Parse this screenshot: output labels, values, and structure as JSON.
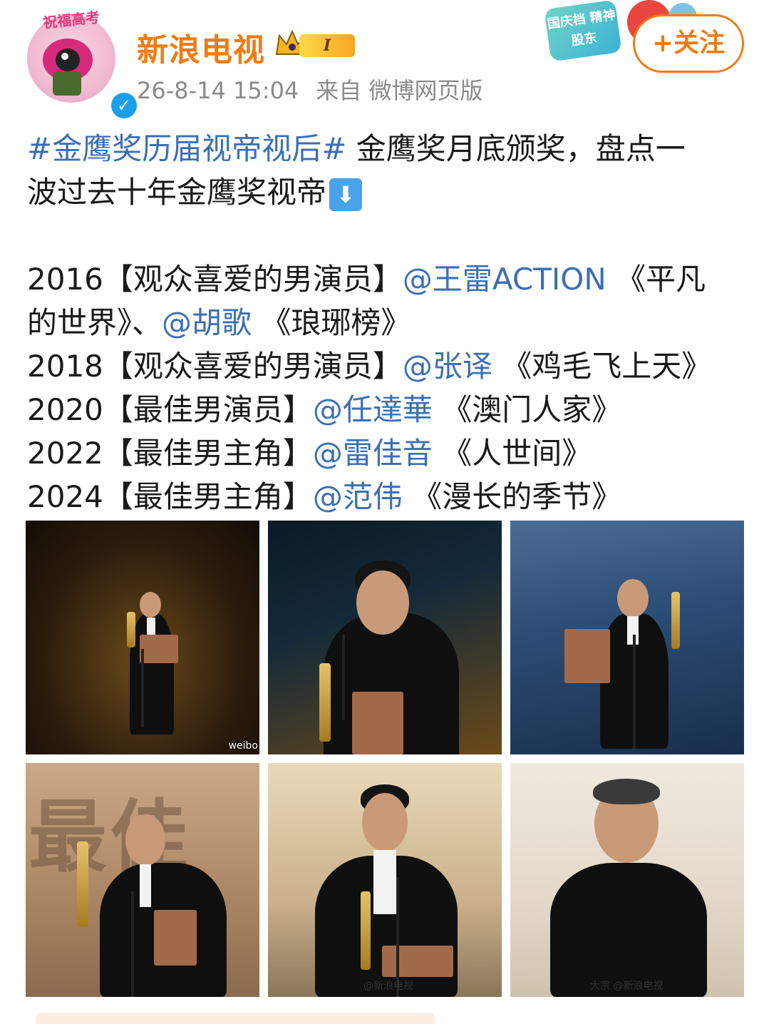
{
  "post": {
    "username": "新浪电视",
    "level": "I",
    "timestamp": "26-8-14 15:04",
    "source": "来自 微博网页版",
    "follow_label": "+关注",
    "avatar_caption": "祝福高考",
    "promo_text": "国庆档 精神股东",
    "body": {
      "hashtag": "#金鹰奖历届视帝视后#",
      "intro_1": " 金鹰奖月底颁奖，盘点一",
      "intro_2": "波过去十年金鹰奖视帝",
      "entries": [
        {
          "year": "2016",
          "category": "【观众喜爱的男演员】",
          "mention": "@王雷ACTION",
          "work": " 《平凡",
          "mention2": "@胡歌",
          "work_cont": "的世界》、",
          "work2": " 《琅琊榜》"
        },
        {
          "year": "2018",
          "category": "【观众喜爱的男演员】",
          "mention": "@张译",
          "work": " 《鸡毛飞上天》"
        },
        {
          "year": "2020",
          "category": "【最佳男演员】",
          "mention": "@任達華",
          "work": " 《澳门人家》"
        },
        {
          "year": "2022",
          "category": "【最佳男主角】",
          "mention": "@雷佳音",
          "work": " 《人世间》"
        },
        {
          "year": "2024",
          "category": "【最佳男主角】",
          "mention": "@范伟",
          "work": " 《漫长的季节》"
        }
      ]
    }
  },
  "photos": {
    "watermark_weibo": "weibo",
    "watermark_sina": "@新浪电视",
    "watermark_sina2": "@新浪电视",
    "watermark_partial": "大宗",
    "p4_backdrop": "最佳"
  },
  "colors": {
    "username": "#f07b12",
    "link": "#3b6fb5",
    "meta": "#8a8a8a",
    "follow": "#f07b12"
  }
}
